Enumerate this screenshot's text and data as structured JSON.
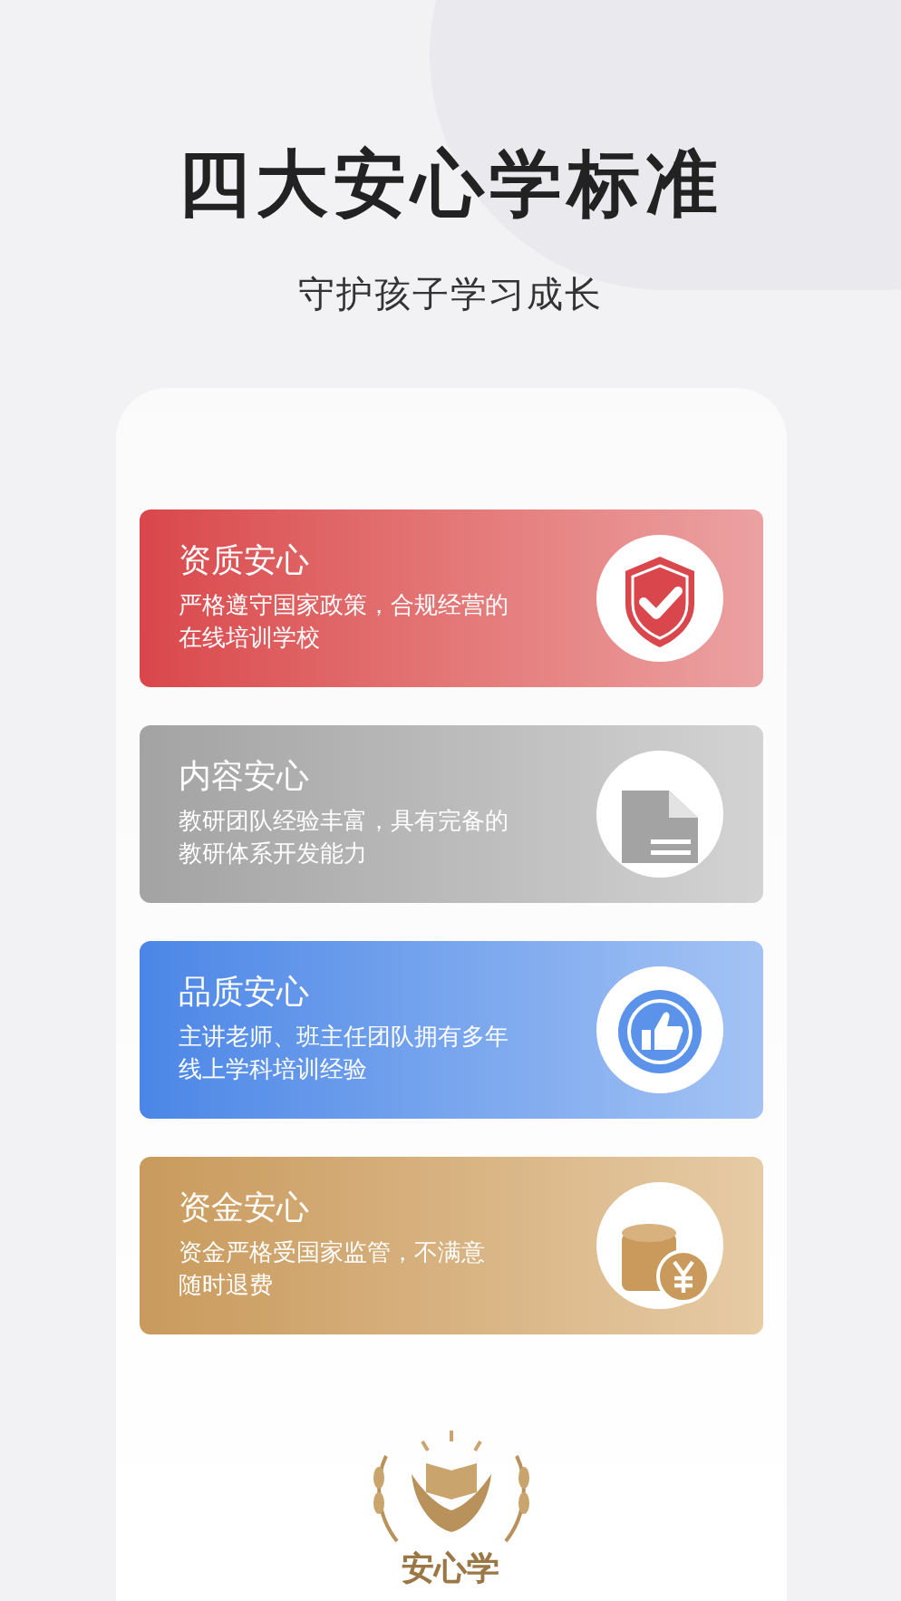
{
  "title": "四大安心学标准",
  "subtitle": "守护孩子学习成长",
  "cards": [
    {
      "kind": "shield",
      "title": "资质安心",
      "lines": [
        "严格遵守国家政策，合规经营的",
        "在线培训学校"
      ]
    },
    {
      "kind": "document",
      "title": "内容安心",
      "lines": [
        "教研团队经验丰富，具有完备的",
        "教研体系开发能力"
      ]
    },
    {
      "kind": "badge",
      "title": "品质安心",
      "lines": [
        "主讲老师、班主任团队拥有多年",
        "线上学科培训经验"
      ]
    },
    {
      "kind": "coins",
      "title": "资金安心",
      "lines": [
        "资金严格受国家监管，不满意",
        "随时退费"
      ]
    }
  ],
  "logo": {
    "text": "安心学"
  }
}
